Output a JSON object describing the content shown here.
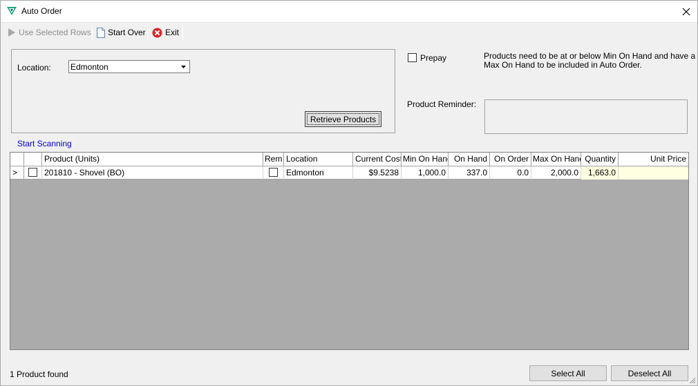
{
  "window": {
    "title": "Auto Order"
  },
  "toolbar": {
    "use_selected_rows": "Use Selected Rows",
    "start_over": "Start Over",
    "exit": "Exit"
  },
  "form": {
    "location_label": "Location:",
    "location_value": "Edmonton",
    "retrieve_button": "Retrieve Products",
    "prepay_label": "Prepay",
    "info_text_line1": "Products need to be at or below Min On Hand and have a",
    "info_text_line2": "Max On Hand to be included in Auto Order.",
    "reminder_label": "Product Reminder:",
    "start_scanning": "Start Scanning"
  },
  "grid": {
    "columns": {
      "product": "Product (Units)",
      "rem": "Rem",
      "location": "Location",
      "current_cost": "Current Cost",
      "min_on_hand": "Min On Hand",
      "on_hand": "On Hand",
      "on_order": "On Order",
      "max_on_hand": "Max On Hand",
      "quantity": "Quantity",
      "unit_price": "Unit Price"
    },
    "rows": [
      {
        "indicator": ">",
        "product": "201810 - Shovel (BO)",
        "location": "Edmonton",
        "current_cost": "$9.5238",
        "min_on_hand": "1,000.0",
        "on_hand": "337.0",
        "on_order": "0.0",
        "max_on_hand": "2,000.0",
        "quantity": "1,663.0",
        "unit_price": ""
      }
    ]
  },
  "status": {
    "text": "1 Product found"
  },
  "footer": {
    "select_all": "Select All",
    "deselect_all": "Deselect All"
  },
  "colors": {
    "link": "#0000cc",
    "editable_cell": "#ffffe1",
    "exit_red": "#d9262c",
    "app_icon_green": "#1aa37a"
  }
}
